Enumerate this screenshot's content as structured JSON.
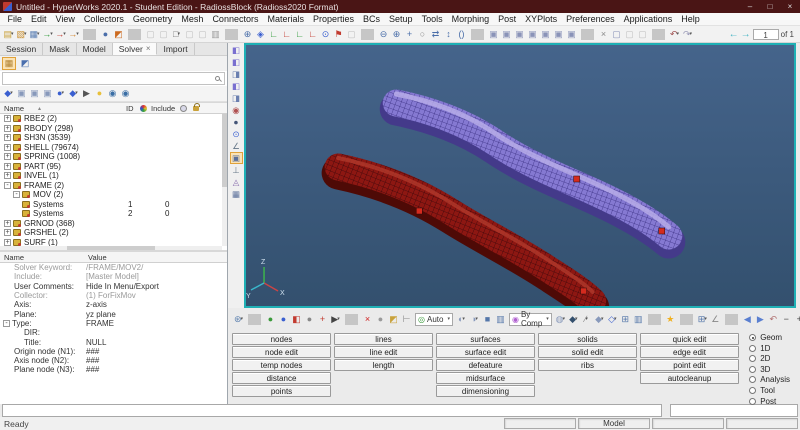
{
  "window": {
    "title": "Untitled - HyperWorks 2020.1 - Student Edition - RadiossBlock (Radioss2020 Format)",
    "controls": {
      "minimize": "–",
      "maximize": "□",
      "close": "×"
    }
  },
  "menubar": {
    "items": [
      "File",
      "Edit",
      "View",
      "Collectors",
      "Geometry",
      "Mesh",
      "Connectors",
      "Materials",
      "Properties",
      "BCs",
      "Setup",
      "Tools",
      "Morphing",
      "Post",
      "XYPlots",
      "Preferences",
      "Applications",
      "Help"
    ]
  },
  "toolbar": {
    "icons": [
      {
        "name": "new-session-icon",
        "g": "▤",
        "c": "#caa23a",
        "dd": true
      },
      {
        "name": "open-model-icon",
        "g": "▧",
        "c": "#c98f2f",
        "dd": true
      },
      {
        "name": "save-model-icon",
        "g": "▦",
        "c": "#5b7fb4",
        "dd": true
      },
      {
        "name": "import-icon",
        "g": "→",
        "c": "#2f9a38",
        "dd": true
      },
      {
        "name": "export-icon",
        "g": "→",
        "c": "#c23a2f",
        "dd": true
      },
      {
        "name": "run-solver-icon",
        "g": "→",
        "c": "#d5862c",
        "dd": true
      },
      {
        "sep": true
      },
      {
        "name": "user-profile-icon",
        "g": "●",
        "c": "#4a6ea9"
      },
      {
        "name": "color-mode-icon",
        "g": "◩",
        "c": "#cc6a1f"
      },
      {
        "sep": true
      },
      {
        "name": "mask-icon",
        "g": "▢",
        "c": "#c0c0c0"
      },
      {
        "name": "reverse-mask-icon",
        "g": "▢",
        "c": "#c0c0c0"
      },
      {
        "name": "unmask-all-icon",
        "g": "□",
        "c": "#777777",
        "dd": true
      },
      {
        "name": "mask-adjacent-icon",
        "g": "▢",
        "c": "#c0c0c0"
      },
      {
        "name": "spherical-clip-icon",
        "g": "▢",
        "c": "#c0c0c0"
      },
      {
        "name": "entity-window-icon",
        "g": "▥",
        "c": "#9a9a9a"
      },
      {
        "sep": true
      },
      {
        "name": "zoom-select-icon",
        "g": "⊕",
        "c": "#4a6ea9"
      },
      {
        "name": "fit-view-icon",
        "g": "◈",
        "c": "#3a5fd0"
      },
      {
        "name": "axis-xy-icon",
        "g": "∟",
        "c": "#2f9a38"
      },
      {
        "name": "axis-xz-icon",
        "g": "∟",
        "c": "#c23a2f"
      },
      {
        "name": "axis-yz-icon",
        "g": "∟",
        "c": "#2f9a38"
      },
      {
        "name": "axis-iso-icon",
        "g": "∟",
        "c": "#c23a2f"
      },
      {
        "name": "view-center-icon",
        "g": "⊙",
        "c": "#3a5fd0"
      },
      {
        "name": "flag-view-icon",
        "g": "⚑",
        "c": "#c23a2f"
      },
      {
        "name": "saved-view-icon",
        "g": "▢",
        "c": "#c0c0c0"
      },
      {
        "sep": true
      },
      {
        "name": "zoom-out-icon",
        "g": "⊖",
        "c": "#4a6ea9"
      },
      {
        "name": "zoom-in-icon",
        "g": "⊕",
        "c": "#4a6ea9"
      },
      {
        "name": "pan-icon",
        "g": "+",
        "c": "#4a6ea9"
      },
      {
        "name": "grab-icon",
        "g": "○",
        "c": "#888888"
      },
      {
        "name": "arrows-lr-icon",
        "g": "⇄",
        "c": "#4a6ea9"
      },
      {
        "name": "arrows-ud-icon",
        "g": "↕",
        "c": "#4a6ea9"
      },
      {
        "name": "brackets-icon",
        "g": "()",
        "c": "#4a6ea9"
      },
      {
        "sep": true
      },
      {
        "name": "window-layout-1-icon",
        "g": "▣",
        "c": "#8a93b8"
      },
      {
        "name": "window-layout-2-icon",
        "g": "▣",
        "c": "#8a93b8"
      },
      {
        "name": "window-layout-3-icon",
        "g": "▣",
        "c": "#8a93b8"
      },
      {
        "name": "window-layout-4-icon",
        "g": "▣",
        "c": "#8a93b8"
      },
      {
        "name": "window-layout-5-icon",
        "g": "▣",
        "c": "#8a93b8"
      },
      {
        "name": "window-layout-6-icon",
        "g": "▣",
        "c": "#8a93b8"
      },
      {
        "name": "window-layout-7-icon",
        "g": "▣",
        "c": "#8a93b8"
      },
      {
        "sep": true
      },
      {
        "name": "cut-icon",
        "g": "×",
        "c": "#888888"
      },
      {
        "name": "copy-icon",
        "g": "▢",
        "c": "#8a93b8"
      },
      {
        "name": "paste-icon",
        "g": "▢",
        "c": "#c0c0c0"
      },
      {
        "name": "capture-icon",
        "g": "▢",
        "c": "#c0c0c0"
      },
      {
        "sep": true
      },
      {
        "name": "undo-icon",
        "g": "↶",
        "c": "#a05050",
        "dd": true
      },
      {
        "name": "redo-icon",
        "g": "↷",
        "c": "#9a9ab8",
        "dd": true
      }
    ],
    "pager": {
      "back": "←",
      "forward": "→",
      "page": "1",
      "of": "of 1"
    }
  },
  "left_panel": {
    "tabs": [
      {
        "label": "Session"
      },
      {
        "label": "Mask"
      },
      {
        "label": "Model"
      },
      {
        "label": "Solver",
        "close": "×",
        "active": true
      },
      {
        "label": "Import"
      }
    ],
    "view_icons": [
      {
        "name": "browser-view-icon",
        "g": "▦",
        "c": "#b08030",
        "sel": true
      },
      {
        "name": "browser-config-icon",
        "g": "◩",
        "c": "#4a6fae"
      }
    ],
    "search": {
      "placeholder": ""
    },
    "tools_left": [
      {
        "name": "entity-create-icon",
        "g": "◆",
        "c": "#3a5fd0",
        "dd": true
      },
      {
        "name": "component-tool-1-icon",
        "g": "▣",
        "c": "#8899bb"
      },
      {
        "name": "component-tool-2-icon",
        "g": "▣",
        "c": "#8899bb"
      },
      {
        "name": "component-tool-3-icon",
        "g": "▣",
        "c": "#8899bb"
      }
    ],
    "tools_right": [
      {
        "name": "global-display-icon",
        "g": "●",
        "c": "#3a5fd0",
        "dd": true
      },
      {
        "name": "entity-display-icon",
        "g": "◆",
        "c": "#3a5fd0",
        "dd": true
      },
      {
        "name": "selector-arrow-icon",
        "g": "▶",
        "c": "#555555"
      },
      {
        "name": "isolate-bulb-icon",
        "g": "●",
        "c": "#e8c03a"
      },
      {
        "name": "show-eye-icon",
        "g": "◉",
        "c": "#3a6ea5"
      },
      {
        "name": "hide-eye-icon",
        "g": "◉",
        "c": "#3a6ea5"
      }
    ],
    "tree": {
      "header": {
        "name": "Name",
        "id": "ID",
        "include": "Include"
      },
      "rows": [
        {
          "d": 0,
          "exp": "+",
          "icon": "component",
          "label": "RBE2  (2)"
        },
        {
          "d": 0,
          "exp": "+",
          "icon": "component",
          "label": "RBODY  (298)"
        },
        {
          "d": 0,
          "exp": "+",
          "icon": "component",
          "label": "SH3N  (3539)"
        },
        {
          "d": 0,
          "exp": "+",
          "icon": "component",
          "label": "SHELL  (79674)"
        },
        {
          "d": 0,
          "exp": "+",
          "icon": "component",
          "label": "SPRING  (1008)"
        },
        {
          "d": 0,
          "exp": "+",
          "icon": "component",
          "label": "PART  (95)"
        },
        {
          "d": 0,
          "exp": "+",
          "icon": "component",
          "label": "INVEL  (1)"
        },
        {
          "d": 0,
          "exp": "-",
          "icon": "component",
          "label": "FRAME  (2)"
        },
        {
          "d": 1,
          "exp": "-",
          "icon": "folder",
          "label": "MOV  (2)"
        },
        {
          "d": 2,
          "icon": "system",
          "label": "Systems",
          "id": "1",
          "include": "0",
          "selected": true
        },
        {
          "d": 2,
          "icon": "system",
          "label": "Systems",
          "id": "2",
          "include": "0",
          "selected": true
        },
        {
          "d": 0,
          "exp": "+",
          "icon": "component",
          "label": "GRNOD  (368)"
        },
        {
          "d": 0,
          "exp": "+",
          "icon": "component",
          "label": "GRSHEL  (2)"
        },
        {
          "d": 0,
          "exp": "+",
          "icon": "component",
          "label": "SURF  (1)"
        }
      ]
    },
    "props": {
      "header": {
        "name": "Name",
        "value": "Value"
      },
      "rows": [
        {
          "name": "Solver Keyword:",
          "value": "/FRAME/MOV2/",
          "gray": true
        },
        {
          "name": "Include:",
          "value": "[Master Model]",
          "gray": true
        },
        {
          "name": "User Comments:",
          "value": "Hide In Menu/Export"
        },
        {
          "name": "Collector:",
          "value": "(1) ForFixMov",
          "gray": true
        },
        {
          "name": "Axis:",
          "value": "z-axis"
        },
        {
          "name": "Plane:",
          "value": "yz plane"
        },
        {
          "name": "Type:",
          "value": "FRAME",
          "exp": "-"
        },
        {
          "name": "DIR:",
          "value": "",
          "d": 1
        },
        {
          "name": "Title:",
          "value": "NULL",
          "d": 1
        },
        {
          "name": "Origin node (N1):",
          "value": "###"
        },
        {
          "name": "Axis node (N2):",
          "value": "###"
        },
        {
          "name": "Plane node (N3):",
          "value": "###"
        }
      ]
    }
  },
  "viewport": {
    "triad": {
      "x": "X",
      "y": "Y",
      "z": "Z"
    },
    "strip_icons": [
      {
        "name": "section-plane-1-icon",
        "g": "◧",
        "c": "#7a6fd0"
      },
      {
        "name": "section-plane-2-icon",
        "g": "◧",
        "c": "#7a6fd0"
      },
      {
        "name": "section-plane-3-icon",
        "g": "◨",
        "c": "#6a7fb0"
      },
      {
        "name": "section-plane-4-icon",
        "g": "◧",
        "c": "#7a6fd0"
      },
      {
        "name": "section-plane-5-icon",
        "g": "◨",
        "c": "#6a7fb0"
      },
      {
        "name": "clip-sphere-icon",
        "g": "◉",
        "c": "#b05050"
      },
      {
        "name": "binocular-icon",
        "g": "●",
        "c": "#445577"
      },
      {
        "name": "target-icon",
        "g": "⊙",
        "c": "#3a5fd0"
      },
      {
        "name": "ruler-icon",
        "g": "∠",
        "c": "#667788"
      },
      {
        "name": "shade-mode-icon",
        "g": "▣",
        "c": "#5a6f9a",
        "sel": true
      },
      {
        "name": "wire-mode-icon",
        "g": "⊥",
        "c": "#667788"
      },
      {
        "name": "feature-mode-icon",
        "g": "◬",
        "c": "#8a6fae"
      },
      {
        "name": "mesh-mode-icon",
        "g": "▦",
        "c": "#5a6f9a"
      }
    ]
  },
  "bottom_toolbar": {
    "left_icons": [
      {
        "name": "options-gear-icon",
        "g": "⊛",
        "c": "#5a7fae",
        "dd": true
      },
      {
        "sep": true
      },
      {
        "name": "shaded-elems-icon",
        "g": "●",
        "c": "#3a9a3a"
      },
      {
        "name": "shaded-geom-icon",
        "g": "●",
        "c": "#3a5fd0"
      },
      {
        "name": "elem-handles-icon",
        "g": "◧",
        "c": "#c23a2f"
      },
      {
        "name": "geom-handles-icon",
        "g": "●",
        "c": "#888888"
      },
      {
        "name": "add-handle-icon",
        "g": "+",
        "c": "#c23a2f"
      },
      {
        "name": "select-arrow-icon",
        "g": "▶",
        "c": "#444444",
        "dd": true
      },
      {
        "sep": true
      },
      {
        "name": "delete-x-icon",
        "g": "×",
        "c": "#d02020"
      },
      {
        "name": "sphere-tool-icon",
        "g": "●",
        "c": "#9a9a9a"
      },
      {
        "name": "folder-tool-icon",
        "g": "◩",
        "c": "#c9a23a"
      },
      {
        "name": "wand-tool-icon",
        "g": "⊢",
        "c": "#888888"
      }
    ],
    "auto_combo": {
      "icon_g": "◎",
      "icon_c": "#3a9a3a",
      "label": "Auto"
    },
    "mid_icons": [
      {
        "name": "wireframe-mode-icon",
        "g": "◐",
        "c": "#8899bb",
        "dd": true
      },
      {
        "name": "shaded-mode-icon",
        "g": "◑",
        "c": "#8899bb",
        "dd": true
      },
      {
        "name": "solid-cube-icon",
        "g": "■",
        "c": "#5577aa"
      },
      {
        "name": "monitor-icon",
        "g": "▥",
        "c": "#5577aa"
      }
    ],
    "bycomp_combo": {
      "icon_g": "◉",
      "icon_c": "#b05fd0",
      "label": "By Comp"
    },
    "right_icons": [
      {
        "name": "wire-globe-icon",
        "g": "◍",
        "c": "#8899bb",
        "dd": true
      },
      {
        "name": "dark-cube-icon",
        "g": "◆",
        "c": "#334f6d",
        "dd": true
      },
      {
        "name": "line-style-icon",
        "g": "∕",
        "c": "#888888",
        "dd": true
      },
      {
        "name": "gray-diamond-icon",
        "g": "◆",
        "c": "#8899bb",
        "dd": true
      },
      {
        "name": "blue-diamond-icon",
        "g": "◇",
        "c": "#3a5fd0",
        "dd": true
      },
      {
        "name": "node-style-icon",
        "g": "⊞",
        "c": "#5577aa"
      },
      {
        "name": "screen-icon",
        "g": "▥",
        "c": "#5577aa"
      },
      {
        "sep": true
      },
      {
        "name": "favorites-star-icon",
        "g": "★",
        "c": "#f0b020"
      },
      {
        "sep": true
      },
      {
        "name": "grid-icon",
        "g": "⊞",
        "c": "#5577aa",
        "dd": true
      },
      {
        "name": "measure-icon",
        "g": "∠",
        "c": "#888888"
      },
      {
        "sep": true
      },
      {
        "name": "view-back-icon",
        "g": "◀",
        "c": "#5a7fd0"
      },
      {
        "name": "view-forward-icon",
        "g": "▶",
        "c": "#5a7fd0"
      },
      {
        "name": "view-undo-icon",
        "g": "↶",
        "c": "#b07070"
      }
    ],
    "end_icons": [
      {
        "name": "minus-icon",
        "g": "−",
        "c": "#444444"
      },
      {
        "name": "plus-icon",
        "g": "+",
        "c": "#444444"
      },
      {
        "name": "redo-view-icon",
        "g": "↷",
        "c": "#b07070"
      }
    ]
  },
  "panel": {
    "columns": [
      {
        "buttons": [
          "nodes",
          "node edit",
          "temp nodes",
          "distance",
          "points"
        ]
      },
      {
        "buttons": [
          "lines",
          "line edit",
          "length"
        ]
      },
      {
        "buttons": [
          "surfaces",
          "surface edit",
          "defeature",
          "midsurface",
          "dimensioning"
        ]
      },
      {
        "buttons": [
          "solids",
          "solid edit",
          "ribs"
        ]
      },
      {
        "buttons": [
          "quick edit",
          "edge edit",
          "point edit",
          "autocleanup"
        ]
      }
    ]
  },
  "mode_radios": {
    "options": [
      {
        "label": "Geom",
        "selected": true
      },
      {
        "label": "1D"
      },
      {
        "label": "2D"
      },
      {
        "label": "3D"
      },
      {
        "label": "Analysis"
      },
      {
        "label": "Tool"
      },
      {
        "label": "Post"
      }
    ]
  },
  "statusbar": {
    "ready": "Ready",
    "segments": [
      "",
      "Model",
      "",
      ""
    ]
  }
}
